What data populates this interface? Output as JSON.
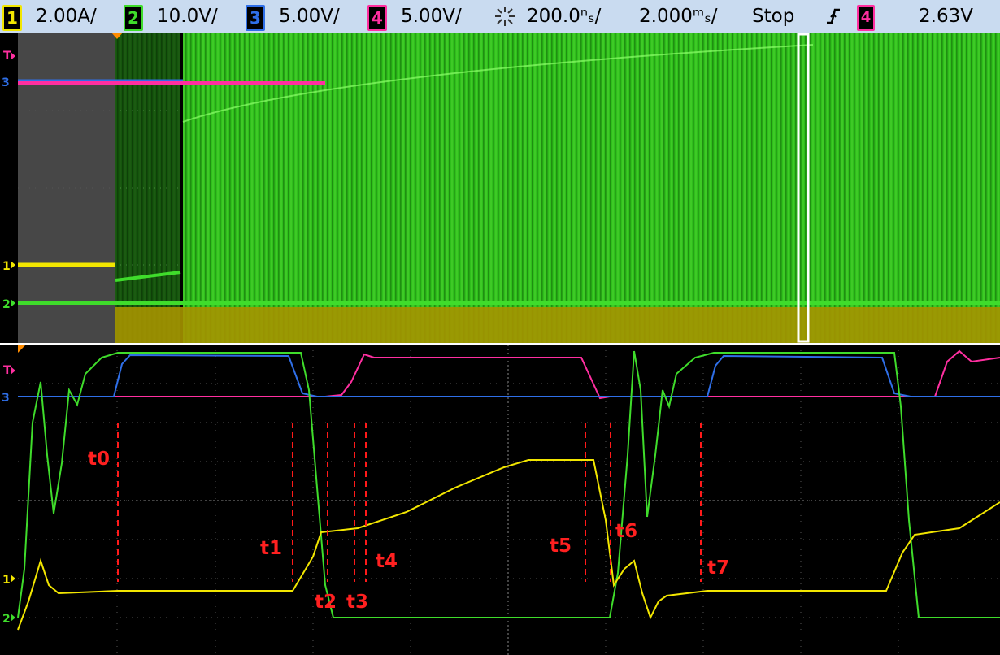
{
  "status_bar": {
    "ch1": {
      "num": "1",
      "scale": "2.00A/",
      "color": "#f2e600"
    },
    "ch2": {
      "num": "2",
      "scale": "10.0V/",
      "color": "#3fdc2b"
    },
    "ch3": {
      "num": "3",
      "scale": "5.00V/",
      "color": "#2f6fe8"
    },
    "ch4": {
      "num": "4",
      "scale": "5.00V/",
      "color": "#ff2fa0"
    },
    "acq_icon": "sunburst-icon",
    "zoom_timebase": "200.0ⁿₛ/",
    "main_timebase": "2.000ᵐₛ/",
    "run_state": "Stop",
    "trigger_slope_icon": "rising-edge-icon",
    "trigger_channel": "4",
    "trigger_level": "2.63V"
  },
  "markers": {
    "trigger": "T",
    "ch1": "1",
    "ch2": "2",
    "ch3": "3"
  },
  "time_labels": [
    "t0",
    "t1",
    "t2",
    "t3",
    "t4",
    "t5",
    "t6",
    "t7"
  ]
}
